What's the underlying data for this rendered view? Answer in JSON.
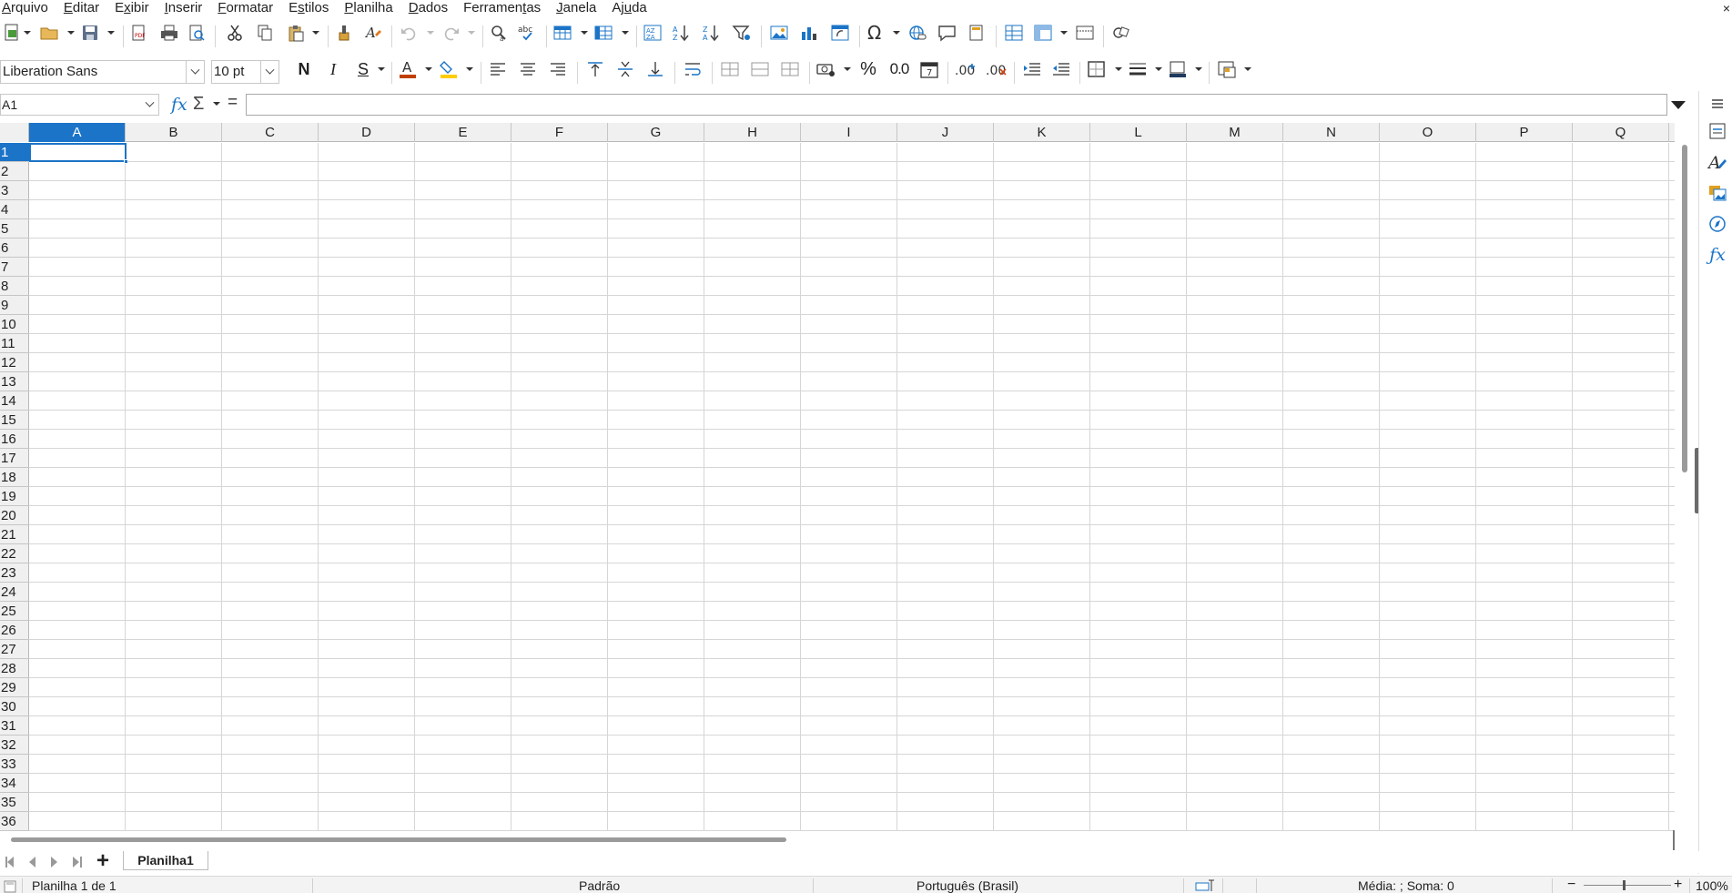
{
  "menu": {
    "items": [
      {
        "pre": "",
        "ul": "A",
        "post": "rquivo"
      },
      {
        "pre": "",
        "ul": "E",
        "post": "ditar"
      },
      {
        "pre": "E",
        "ul": "x",
        "post": "ibir"
      },
      {
        "pre": "",
        "ul": "I",
        "post": "nserir"
      },
      {
        "pre": "",
        "ul": "F",
        "post": "ormatar"
      },
      {
        "pre": "E",
        "ul": "s",
        "post": "tilos"
      },
      {
        "pre": "",
        "ul": "P",
        "post": "lanilha"
      },
      {
        "pre": "",
        "ul": "D",
        "post": "ados"
      },
      {
        "pre": "Ferramen",
        "ul": "t",
        "post": "as"
      },
      {
        "pre": "",
        "ul": "J",
        "post": "anela"
      },
      {
        "pre": "Aj",
        "ul": "u",
        "post": "da"
      }
    ],
    "close": "×"
  },
  "format_toolbar": {
    "font_name": "Liberation Sans",
    "font_size": "10 pt",
    "bold": "N",
    "italic": "I",
    "underline": "S",
    "percent": "%",
    "number": "0.0"
  },
  "formula_bar": {
    "name_box": "A1",
    "fx": "fx",
    "sum": "Σ",
    "equals": "=",
    "content": ""
  },
  "grid": {
    "columns": [
      "A",
      "B",
      "C",
      "D",
      "E",
      "F",
      "G",
      "H",
      "I",
      "J",
      "K",
      "L",
      "M",
      "N",
      "O",
      "P",
      "Q"
    ],
    "rows": [
      "1",
      "2",
      "3",
      "4",
      "5",
      "6",
      "7",
      "8",
      "9",
      "10",
      "11",
      "12",
      "13",
      "14",
      "15",
      "16",
      "17",
      "18",
      "19",
      "20",
      "21",
      "22",
      "23",
      "24",
      "25",
      "26",
      "27",
      "28",
      "29",
      "30",
      "31",
      "32",
      "33",
      "34",
      "35",
      "36"
    ],
    "selected_cell": "A1"
  },
  "sheet_tabs": {
    "add": "+",
    "tabs": [
      "Planilha1"
    ]
  },
  "status": {
    "sheet": "Planilha 1 de 1",
    "style": "Padrão",
    "language": "Português (Brasil)",
    "summary": "Média: ; Soma: 0",
    "zoom": "100%"
  },
  "colors": {
    "accent": "#1b74c7",
    "header_bg": "#f0f0f0",
    "font_color": "#c04000",
    "highlight_color": "#ffcc00"
  }
}
